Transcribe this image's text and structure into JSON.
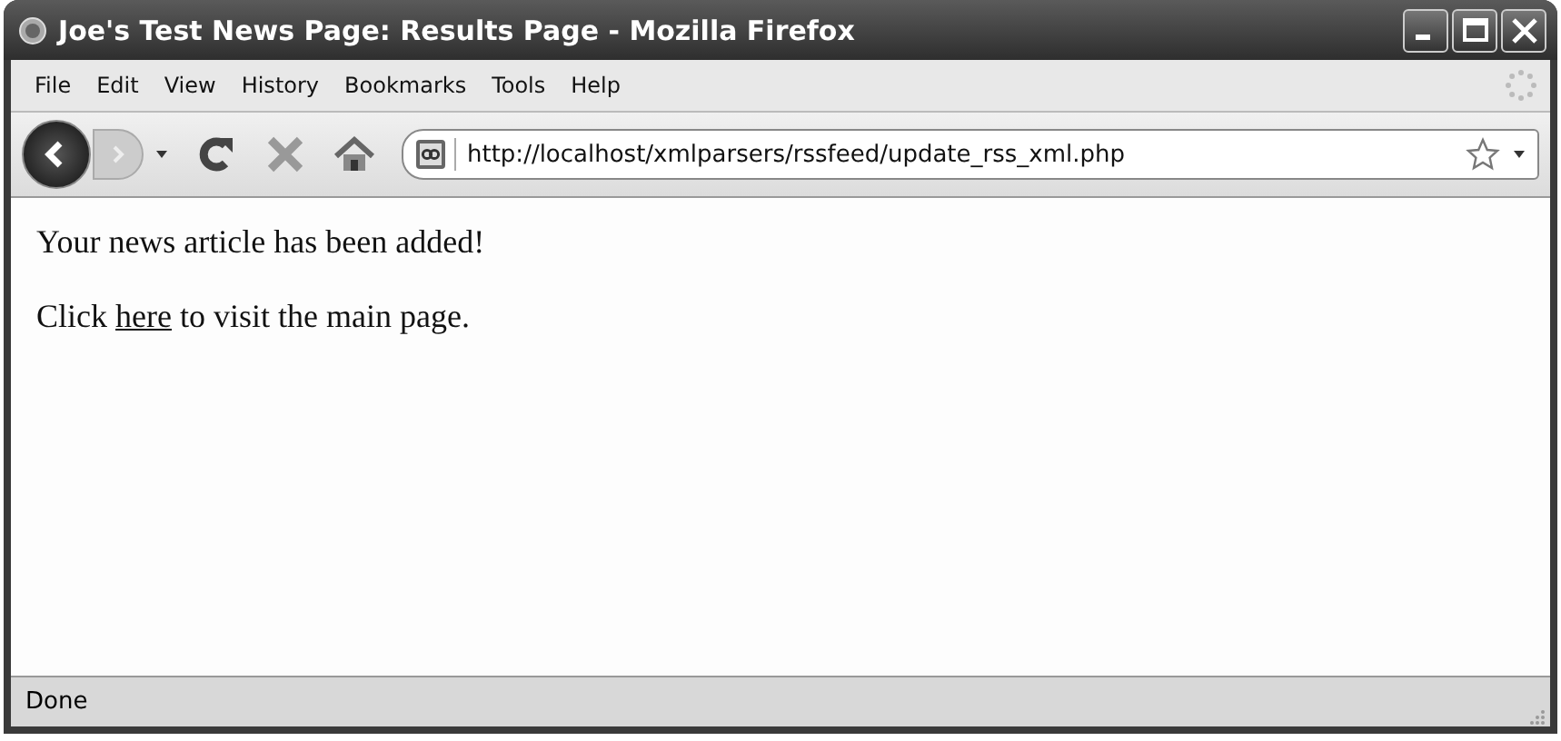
{
  "window": {
    "title": "Joe's Test News Page: Results Page - Mozilla Firefox"
  },
  "menu": [
    "File",
    "Edit",
    "View",
    "History",
    "Bookmarks",
    "Tools",
    "Help"
  ],
  "address_bar": {
    "value": "http://localhost/xmlparsers/rssfeed/update_rss_xml.php"
  },
  "content": {
    "message": "Your news article has been added!",
    "link_sentence": {
      "before": "Click ",
      "link": "here",
      "after": " to visit the main page."
    }
  },
  "status_bar": "Done"
}
